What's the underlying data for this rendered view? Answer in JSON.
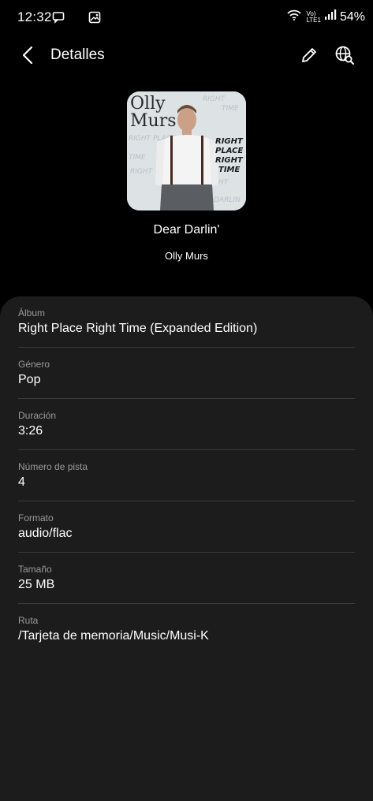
{
  "status_bar": {
    "time": "12:32",
    "battery": "54%",
    "network_label_top": "Vo)",
    "network_label_bottom": "LTE1"
  },
  "header": {
    "title": "Detalles"
  },
  "album_art": {
    "artist_text_line1": "Olly",
    "artist_text_line2": "Murs",
    "album_text_line1": "RIGHT",
    "album_text_line2": "PLACE",
    "album_text_line3": "RIGHT",
    "album_text_line4": "TIME"
  },
  "song": {
    "title": "Dear Darlin'",
    "artist": "Olly Murs"
  },
  "details": [
    {
      "label": "Álbum",
      "value": "Right Place Right Time (Expanded Edition)"
    },
    {
      "label": "Género",
      "value": "Pop"
    },
    {
      "label": "Duración",
      "value": "3:26"
    },
    {
      "label": "Número de pista",
      "value": "4"
    },
    {
      "label": "Formato",
      "value": "audio/flac"
    },
    {
      "label": "Tamaño",
      "value": "25 MB"
    },
    {
      "label": "Ruta",
      "value": "/Tarjeta de memoria/Music/Musi-K"
    }
  ],
  "colors": {
    "background": "#000000",
    "panel": "#1c1c1c",
    "label": "#9a9a9a",
    "divider": "#3a3a3a"
  }
}
